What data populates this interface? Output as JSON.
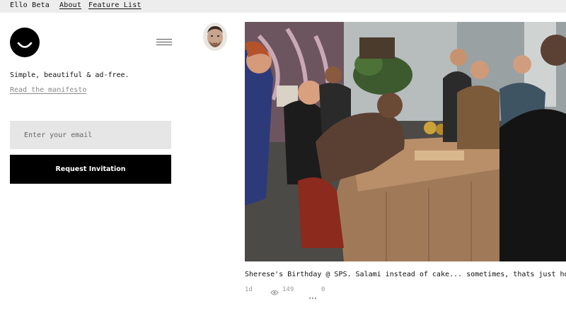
{
  "nav": {
    "brand": "Ello Beta",
    "about": "About",
    "features": "Feature List"
  },
  "sidebar": {
    "tagline": "Simple, beautiful & ad-free.",
    "manifesto_link": "Read the manifesto",
    "email_placeholder": "Enter your email",
    "request_button": "Request Invitation"
  },
  "post": {
    "caption": "Sherese's Birthday @ SPS. Salami instead of cake... sometimes, thats just how it goes",
    "age": "1d",
    "views": "149",
    "comments": "0"
  },
  "icons": {
    "logo": "ello-smile-logo",
    "menu": "hamburger-icon",
    "views": "eye-icon",
    "comments": "ellipsis-icon"
  },
  "colors": {
    "topbar_bg": "#ededed",
    "input_bg": "#e6e6e6",
    "button_bg": "#000000",
    "meta_text": "#9a9a9a"
  }
}
